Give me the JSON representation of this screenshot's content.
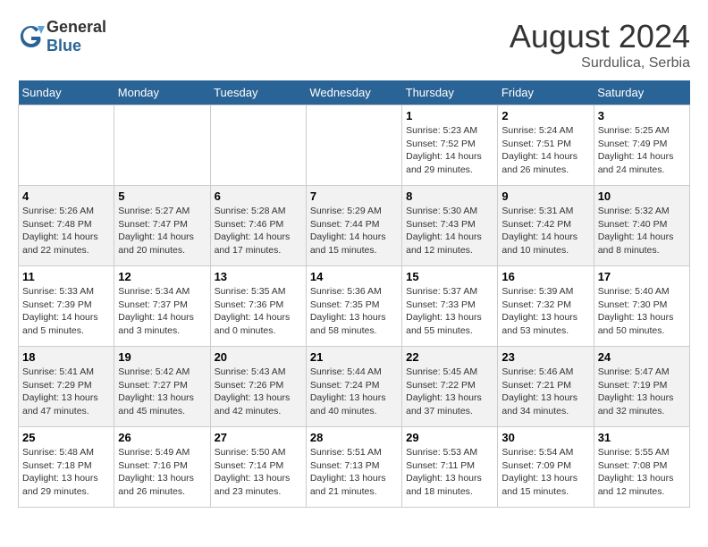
{
  "header": {
    "logo_general": "General",
    "logo_blue": "Blue",
    "month_year": "August 2024",
    "location": "Surdulica, Serbia"
  },
  "days_of_week": [
    "Sunday",
    "Monday",
    "Tuesday",
    "Wednesday",
    "Thursday",
    "Friday",
    "Saturday"
  ],
  "weeks": [
    [
      {
        "day": "",
        "content": ""
      },
      {
        "day": "",
        "content": ""
      },
      {
        "day": "",
        "content": ""
      },
      {
        "day": "",
        "content": ""
      },
      {
        "day": "1",
        "content": "Sunrise: 5:23 AM\nSunset: 7:52 PM\nDaylight: 14 hours and 29 minutes."
      },
      {
        "day": "2",
        "content": "Sunrise: 5:24 AM\nSunset: 7:51 PM\nDaylight: 14 hours and 26 minutes."
      },
      {
        "day": "3",
        "content": "Sunrise: 5:25 AM\nSunset: 7:49 PM\nDaylight: 14 hours and 24 minutes."
      }
    ],
    [
      {
        "day": "4",
        "content": "Sunrise: 5:26 AM\nSunset: 7:48 PM\nDaylight: 14 hours and 22 minutes."
      },
      {
        "day": "5",
        "content": "Sunrise: 5:27 AM\nSunset: 7:47 PM\nDaylight: 14 hours and 20 minutes."
      },
      {
        "day": "6",
        "content": "Sunrise: 5:28 AM\nSunset: 7:46 PM\nDaylight: 14 hours and 17 minutes."
      },
      {
        "day": "7",
        "content": "Sunrise: 5:29 AM\nSunset: 7:44 PM\nDaylight: 14 hours and 15 minutes."
      },
      {
        "day": "8",
        "content": "Sunrise: 5:30 AM\nSunset: 7:43 PM\nDaylight: 14 hours and 12 minutes."
      },
      {
        "day": "9",
        "content": "Sunrise: 5:31 AM\nSunset: 7:42 PM\nDaylight: 14 hours and 10 minutes."
      },
      {
        "day": "10",
        "content": "Sunrise: 5:32 AM\nSunset: 7:40 PM\nDaylight: 14 hours and 8 minutes."
      }
    ],
    [
      {
        "day": "11",
        "content": "Sunrise: 5:33 AM\nSunset: 7:39 PM\nDaylight: 14 hours and 5 minutes."
      },
      {
        "day": "12",
        "content": "Sunrise: 5:34 AM\nSunset: 7:37 PM\nDaylight: 14 hours and 3 minutes."
      },
      {
        "day": "13",
        "content": "Sunrise: 5:35 AM\nSunset: 7:36 PM\nDaylight: 14 hours and 0 minutes."
      },
      {
        "day": "14",
        "content": "Sunrise: 5:36 AM\nSunset: 7:35 PM\nDaylight: 13 hours and 58 minutes."
      },
      {
        "day": "15",
        "content": "Sunrise: 5:37 AM\nSunset: 7:33 PM\nDaylight: 13 hours and 55 minutes."
      },
      {
        "day": "16",
        "content": "Sunrise: 5:39 AM\nSunset: 7:32 PM\nDaylight: 13 hours and 53 minutes."
      },
      {
        "day": "17",
        "content": "Sunrise: 5:40 AM\nSunset: 7:30 PM\nDaylight: 13 hours and 50 minutes."
      }
    ],
    [
      {
        "day": "18",
        "content": "Sunrise: 5:41 AM\nSunset: 7:29 PM\nDaylight: 13 hours and 47 minutes."
      },
      {
        "day": "19",
        "content": "Sunrise: 5:42 AM\nSunset: 7:27 PM\nDaylight: 13 hours and 45 minutes."
      },
      {
        "day": "20",
        "content": "Sunrise: 5:43 AM\nSunset: 7:26 PM\nDaylight: 13 hours and 42 minutes."
      },
      {
        "day": "21",
        "content": "Sunrise: 5:44 AM\nSunset: 7:24 PM\nDaylight: 13 hours and 40 minutes."
      },
      {
        "day": "22",
        "content": "Sunrise: 5:45 AM\nSunset: 7:22 PM\nDaylight: 13 hours and 37 minutes."
      },
      {
        "day": "23",
        "content": "Sunrise: 5:46 AM\nSunset: 7:21 PM\nDaylight: 13 hours and 34 minutes."
      },
      {
        "day": "24",
        "content": "Sunrise: 5:47 AM\nSunset: 7:19 PM\nDaylight: 13 hours and 32 minutes."
      }
    ],
    [
      {
        "day": "25",
        "content": "Sunrise: 5:48 AM\nSunset: 7:18 PM\nDaylight: 13 hours and 29 minutes."
      },
      {
        "day": "26",
        "content": "Sunrise: 5:49 AM\nSunset: 7:16 PM\nDaylight: 13 hours and 26 minutes."
      },
      {
        "day": "27",
        "content": "Sunrise: 5:50 AM\nSunset: 7:14 PM\nDaylight: 13 hours and 23 minutes."
      },
      {
        "day": "28",
        "content": "Sunrise: 5:51 AM\nSunset: 7:13 PM\nDaylight: 13 hours and 21 minutes."
      },
      {
        "day": "29",
        "content": "Sunrise: 5:53 AM\nSunset: 7:11 PM\nDaylight: 13 hours and 18 minutes."
      },
      {
        "day": "30",
        "content": "Sunrise: 5:54 AM\nSunset: 7:09 PM\nDaylight: 13 hours and 15 minutes."
      },
      {
        "day": "31",
        "content": "Sunrise: 5:55 AM\nSunset: 7:08 PM\nDaylight: 13 hours and 12 minutes."
      }
    ]
  ]
}
